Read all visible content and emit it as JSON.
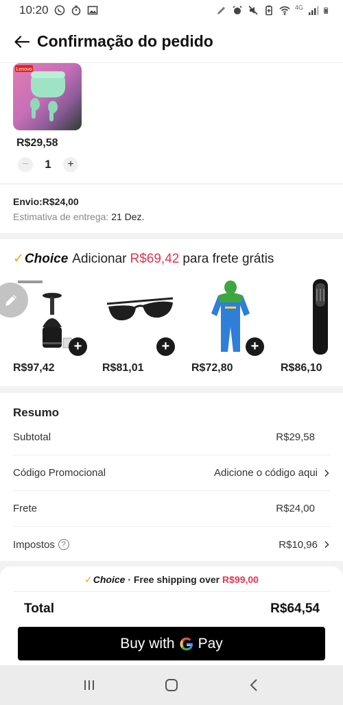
{
  "status": {
    "time": "10:20",
    "network": "4G"
  },
  "header": {
    "title": "Confirmação do pedido"
  },
  "product": {
    "brand_tag": "Lenovo",
    "price": "R$29,58",
    "quantity": "1",
    "minus": "−",
    "plus": "+"
  },
  "shipping": {
    "line": "Envio:R$24,00",
    "estimate_label": "Estimativa de entrega:",
    "estimate_date": "21 Dez."
  },
  "choice": {
    "logo": "Choice",
    "text_before": "Adicionar",
    "amount": "R$69,42",
    "text_after": "para frete grátis",
    "items": [
      {
        "icon": "speaker-stand-icon",
        "price": "R$97,42"
      },
      {
        "icon": "sunglasses-icon",
        "price": "R$81,01"
      },
      {
        "icon": "costume-onesie-icon",
        "price": "R$72,80"
      },
      {
        "icon": "hair-trimmer-icon",
        "price": "R$86,10"
      }
    ]
  },
  "summary": {
    "title": "Resumo",
    "subtotal_label": "Subtotal",
    "subtotal_value": "R$29,58",
    "promo_label": "Código Promocional",
    "promo_value": "Adicione o código aqui",
    "shipping_label": "Frete",
    "shipping_value": "R$24,00",
    "tax_label": "Impostos",
    "tax_value": "R$10,96"
  },
  "bottom": {
    "logo": "Choice",
    "free_ship_text": "· Free shipping over",
    "free_ship_threshold": "R$99,00",
    "total_label": "Total",
    "total_value": "R$64,54",
    "buy_prefix": "Buy with",
    "buy_suffix": "Pay"
  },
  "colors": {
    "accent_red": "#e5344f",
    "choice_check": "#f0a500",
    "button_black": "#000000"
  }
}
